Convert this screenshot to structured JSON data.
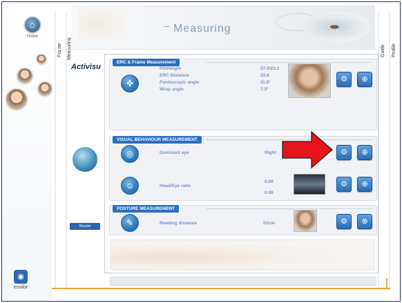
{
  "nav": {
    "home_label": "Home",
    "tab_frame": "Frame",
    "tab_measuring": "Measuring",
    "tab_guide": "Guide",
    "tab_profile": "Profile"
  },
  "header": {
    "title": "Measuring"
  },
  "sidebar": {
    "brand": "Activisu",
    "results_button": "Results"
  },
  "sections": {
    "erc": {
      "title": "ERC & Frame Measurement",
      "rows": [
        {
          "label": "PD/Height",
          "value": "57.0/23.2"
        },
        {
          "label": "ERC Distance",
          "value": "22.8"
        },
        {
          "label": "Pantoscopic angle",
          "value": "11.8°"
        },
        {
          "label": "Wrap angle",
          "value": "7.3°"
        }
      ]
    },
    "visual": {
      "title": "VISUAL BEHAVIOUR MEASUREMENT",
      "dominant_eye": {
        "label": "Dominant eye",
        "value": "Right"
      },
      "head_eye": {
        "label": "Head/Eye ratio",
        "value1": "0.00",
        "value2": "0.00"
      }
    },
    "posture": {
      "title": "POSTURE MEASUREMENT",
      "reading": {
        "label": "Reading distance",
        "value": "52cm"
      }
    }
  },
  "brand_logo": {
    "text": "essilor"
  },
  "colors": {
    "accent": "#2b6fc2",
    "arrow": "#e8141c",
    "orange": "#f2a33c",
    "border": "#1f2c6a"
  }
}
